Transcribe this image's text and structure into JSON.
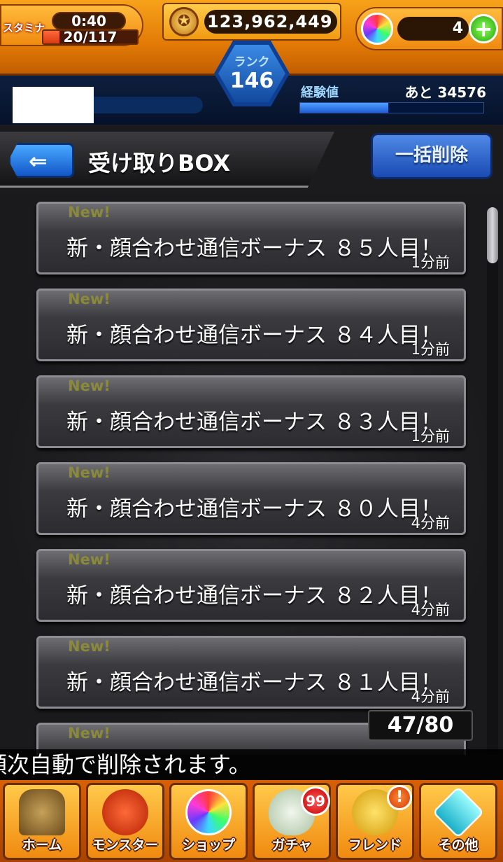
{
  "status": {
    "stamina_label": "スタミナ",
    "stamina_timer": "0:40",
    "stamina_value": "20/117",
    "stamina_fraction": 0.17,
    "coins": "123,962,449",
    "orbs": "4",
    "orb_add_label": "+"
  },
  "rank": {
    "label": "ランク",
    "value": "146"
  },
  "experience": {
    "label": "経験値",
    "remaining": "あと 34576",
    "fraction": 0.48
  },
  "header": {
    "back_label": "⇐",
    "title": "受け取りBOX",
    "bulk_delete_label": "一括削除"
  },
  "items": [
    {
      "new": "New!",
      "text": "新・顔合わせ通信ボーナス ８５人目！",
      "time": "1分前"
    },
    {
      "new": "New!",
      "text": "新・顔合わせ通信ボーナス ８４人目！",
      "time": "1分前"
    },
    {
      "new": "New!",
      "text": "新・顔合わせ通信ボーナス ８３人目！",
      "time": "1分前"
    },
    {
      "new": "New!",
      "text": "新・顔合わせ通信ボーナス ８０人目！",
      "time": "4分前"
    },
    {
      "new": "New!",
      "text": "新・顔合わせ通信ボーナス ８２人目！",
      "time": "4分前"
    },
    {
      "new": "New!",
      "text": "新・顔合わせ通信ボーナス ８１人目！",
      "time": "4分前"
    },
    {
      "new": "New!",
      "text": "",
      "time": ""
    }
  ],
  "counter": "47/80",
  "notice": "順次自動で削除されます。",
  "nav": {
    "home": "ホーム",
    "monster": "モンスター",
    "shop": "ショップ",
    "gacha": "ガチャ",
    "gacha_badge": "99",
    "friend": "フレンド",
    "friend_alert": "!",
    "other": "その他"
  }
}
